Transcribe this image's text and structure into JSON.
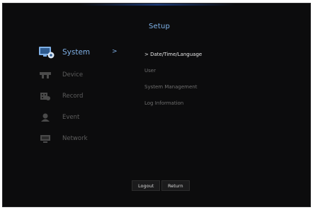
{
  "header": {
    "title": "Setup"
  },
  "sidebar": {
    "items": [
      {
        "label": "System",
        "icon": "system-settings-icon",
        "active": true
      },
      {
        "label": "Device",
        "icon": "device-camera-icon",
        "active": false
      },
      {
        "label": "Record",
        "icon": "record-icon",
        "active": false
      },
      {
        "label": "Event",
        "icon": "event-person-icon",
        "active": false
      },
      {
        "label": "Network",
        "icon": "network-monitor-icon",
        "active": false
      }
    ],
    "active_arrow": ">"
  },
  "submenu": {
    "items": [
      {
        "label": "> Date/Time/Language",
        "selected": true
      },
      {
        "label": "User",
        "selected": false
      },
      {
        "label": "System Management",
        "selected": false
      },
      {
        "label": "Log Information",
        "selected": false
      }
    ]
  },
  "footer": {
    "logout_label": "Logout",
    "return_label": "Return"
  },
  "colors": {
    "background": "#0c0c0d",
    "accent": "#7fb0e6",
    "inactive_text": "#5e5e5e",
    "selected_text": "#e6e6e6"
  }
}
